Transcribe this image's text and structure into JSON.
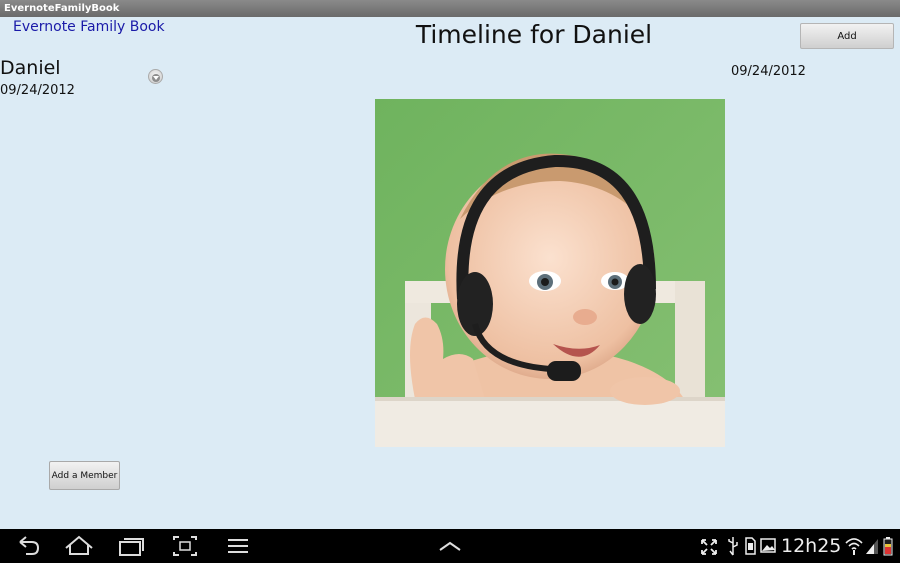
{
  "window": {
    "title": "EvernoteFamilyBook"
  },
  "header": {
    "app_link": "Evernote Family Book",
    "page_title": "Timeline for Daniel",
    "add_label": "Add"
  },
  "member": {
    "name": "Daniel",
    "date": "09/24/2012"
  },
  "timeline": {
    "entries": [
      {
        "date": "09/24/2012",
        "image": "baby-with-headset-photo"
      }
    ]
  },
  "sidebar": {
    "add_member_label": "Add a Member"
  },
  "status_bar": {
    "time": "12h25",
    "icons": [
      "fullscreen-icon",
      "usb-icon",
      "sd-card-icon",
      "gallery-icon",
      "wifi-icon",
      "signal-icon",
      "battery-icon"
    ]
  },
  "nav_bar": {
    "icons": [
      "back-icon",
      "home-icon",
      "recent-apps-icon",
      "screenshot-icon",
      "menu-icon",
      "up-chevron-icon"
    ]
  }
}
